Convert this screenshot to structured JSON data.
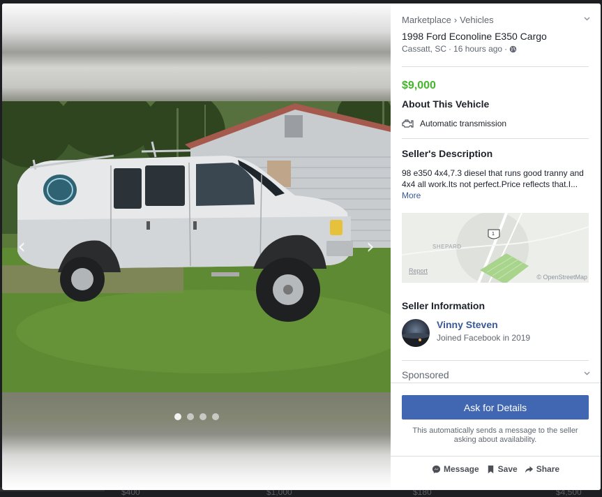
{
  "background_listings": {
    "prices": [
      "$400",
      "$1,000",
      "$180",
      "$4,500"
    ]
  },
  "viewer": {
    "photo_count": 4,
    "active_photo_index": 0,
    "prev_glyph": "‹",
    "next_glyph": "›"
  },
  "panel": {
    "breadcrumb": [
      "Marketplace",
      "Vehicles"
    ],
    "breadcrumb_separator": "›",
    "title": "1998 Ford Econoline E350 Cargo",
    "location": "Cassatt, SC",
    "posted": "16 hours ago",
    "meta_separator": "·",
    "price": "$9,000",
    "about_heading": "About This Vehicle",
    "transmission": "Automatic transmission",
    "description_heading": "Seller's Description",
    "description_text": "98 e350 4x4,7.3 diesel that runs good tranny and 4x4 all work.Its not perfect.Price reflects that.I...",
    "description_more": "More",
    "map": {
      "place_label": "SHEPARD",
      "route_shield": "1",
      "report_label": "Report",
      "attribution": "© OpenStreetMap"
    },
    "seller_heading": "Seller Information",
    "seller_name": "Vinny Steven",
    "seller_joined": "Joined Facebook in 2019",
    "sponsored_label": "Sponsored",
    "ask_button": "Ask for Details",
    "auto_note": "This automatically sends a message to the seller asking about availability.",
    "actions": {
      "message": "Message",
      "save": "Save",
      "share": "Share"
    }
  },
  "colors": {
    "price_green": "#42b72a",
    "brand_blue": "#4267b2",
    "link_blue": "#385898"
  }
}
